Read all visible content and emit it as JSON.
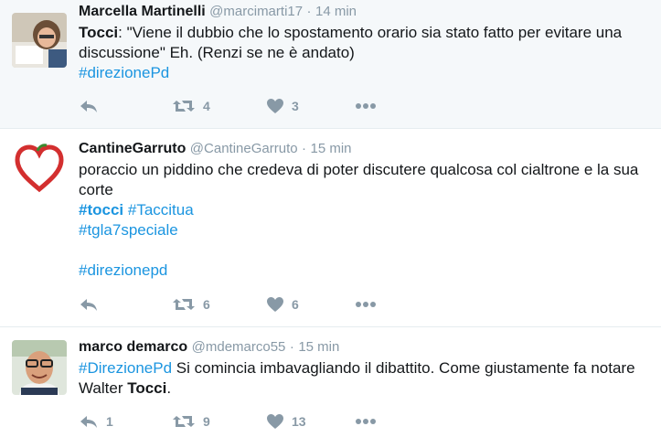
{
  "tweets": [
    {
      "fullname": "Marcella Martinelli",
      "handle": "@marcimarti17",
      "dot": "·",
      "time": "14 min",
      "lines": [
        [
          {
            "t": "Tocci",
            "s": "bold"
          },
          {
            "t": ": \"Viene il dubbio che lo spostamento orario sia stato fatto per evitare una",
            "s": ""
          }
        ],
        [
          {
            "t": "discussione\" Eh. (Renzi se ne è andato)",
            "s": ""
          }
        ],
        [
          {
            "t": "#direzionePd",
            "s": "link"
          }
        ]
      ],
      "reply_count": "",
      "retweet_count": "4",
      "like_count": "3"
    },
    {
      "fullname": "CantineGarruto",
      "handle": "@CantineGarruto",
      "dot": "·",
      "time": "15 min",
      "lines": [
        [
          {
            "t": "poraccio un piddino che credeva di poter discutere qualcosa col cialtrone e la sua",
            "s": ""
          }
        ],
        [
          {
            "t": "corte",
            "s": ""
          }
        ],
        [
          {
            "t": "#tocci",
            "s": "link bold"
          },
          {
            "t": " ",
            "s": ""
          },
          {
            "t": "#Taccitua",
            "s": "link"
          }
        ],
        [
          {
            "t": "#tgla7speciale",
            "s": "link"
          }
        ],
        [],
        [
          {
            "t": "#direzionepd",
            "s": "link"
          }
        ]
      ],
      "reply_count": "",
      "retweet_count": "6",
      "like_count": "6"
    },
    {
      "fullname": "marco demarco",
      "handle": "@mdemarco55",
      "dot": "·",
      "time": "15 min",
      "lines": [
        [
          {
            "t": "#DirezionePd",
            "s": "link"
          },
          {
            "t": " Si comincia imbavagliando  il dibattito. Come giustamente fa notare",
            "s": ""
          }
        ],
        [
          {
            "t": "Walter ",
            "s": ""
          },
          {
            "t": "Tocci",
            "s": "bold"
          },
          {
            "t": ".",
            "s": ""
          }
        ]
      ],
      "reply_count": "1",
      "retweet_count": "9",
      "like_count": "13"
    }
  ],
  "icons": {
    "reply": "reply-icon",
    "retweet": "retweet-icon",
    "like": "heart-icon",
    "more": "more-icon"
  },
  "colors": {
    "link": "#1b95e0",
    "muted": "#8899a6",
    "highlight_bg": "#f5f8fa"
  }
}
